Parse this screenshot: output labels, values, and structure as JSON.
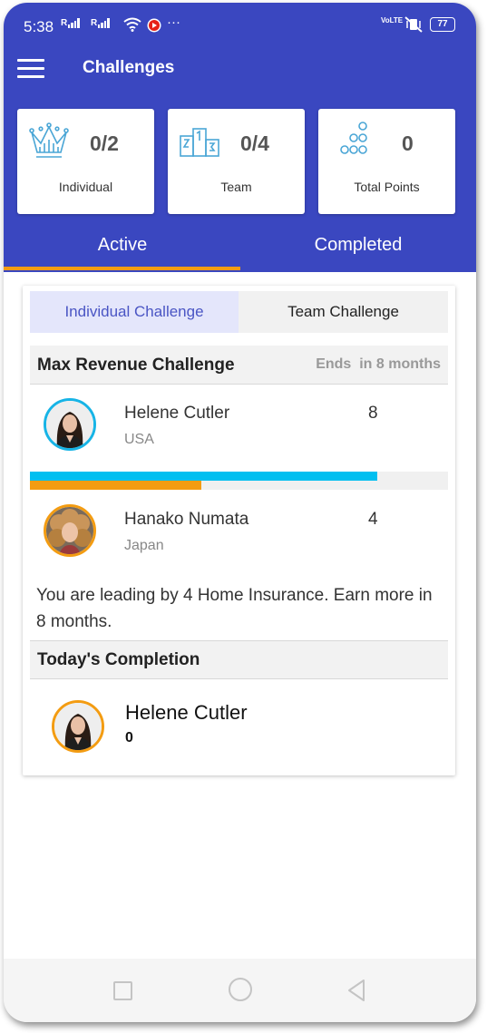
{
  "status_bar": {
    "time": "5:38",
    "sim1": "R",
    "sim2": "R",
    "volte": "VoLTE",
    "battery": "77"
  },
  "toolbar": {
    "title": "Challenges",
    "menu_icon": "hamburger-menu-icon"
  },
  "stats": [
    {
      "icon": "crown-icon",
      "value": "0/2",
      "label": "Individual"
    },
    {
      "icon": "podium-icon",
      "value": "0/4",
      "label": "Team"
    },
    {
      "icon": "coins-stack-icon",
      "value": "0",
      "label": "Total Points"
    }
  ],
  "tabs": [
    {
      "label": "Active",
      "selected": true
    },
    {
      "label": "Completed",
      "selected": false
    }
  ],
  "segment": {
    "options": [
      "Individual Challenge",
      "Team Challenge"
    ],
    "selected": "Individual Challenge"
  },
  "challenge": {
    "name": "Max Revenue Challenge",
    "ends_label": "Ends",
    "ends_value": "in 8 months",
    "participants": [
      {
        "name": "Helene Cutler",
        "country": "USA",
        "score": "8",
        "ring_color": "#17b4e6",
        "progress": 0.83
      },
      {
        "name": "Hanako Numata",
        "country": "Japan",
        "score": "4",
        "ring_color": "#f39c12",
        "progress": 0.41
      }
    ],
    "message": "You are leading by 4 Home Insurance. Earn more in 8 months."
  },
  "today": {
    "title": "Today's Completion",
    "name": "Helene Cutler",
    "value": "0"
  },
  "colors": {
    "primary": "#3a47c0",
    "accent_orange": "#f39c12",
    "accent_blue": "#00bff0"
  }
}
